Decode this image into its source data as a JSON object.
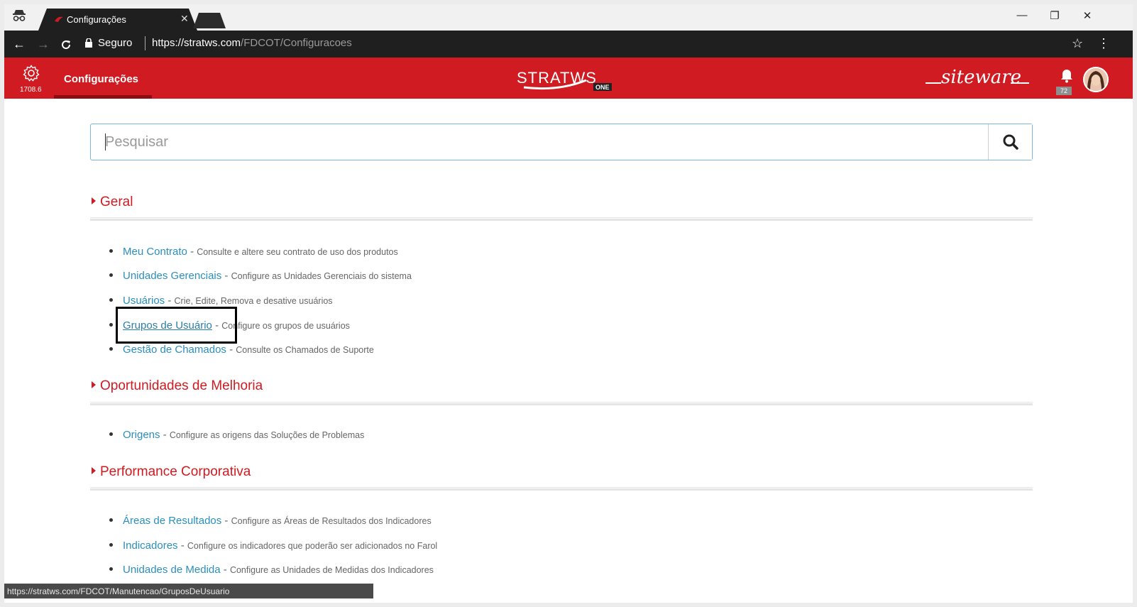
{
  "browser": {
    "tab_title": "Configurações",
    "secure_label": "Seguro",
    "url_host": "https://stratws.com",
    "url_path": "/FDCOT/Configuracoes",
    "status_url": "https://stratws.com/FDCOT/Manutencao/GruposDeUsuario"
  },
  "header": {
    "version": "1708.6",
    "title": "Configurações",
    "logo_text": "STRATWS",
    "logo_badge": "ONE",
    "brand_text": "siteware",
    "notification_count": "72",
    "color": "#cf1b21"
  },
  "search": {
    "placeholder": "Pesquisar"
  },
  "sections": [
    {
      "title": "Geral",
      "items": [
        {
          "link": "Meu Contrato",
          "desc": "Consulte e altere seu contrato de uso dos produtos"
        },
        {
          "link": "Unidades Gerenciais",
          "desc": "Configure as Unidades Gerenciais do sistema"
        },
        {
          "link": "Usuários",
          "desc": "Crie, Edite, Remova e desative usuários"
        },
        {
          "link": "Grupos de Usuário",
          "desc": "Configure os grupos de usuários"
        },
        {
          "link": "Gestão de Chamados",
          "desc": "Consulte os Chamados de Suporte"
        }
      ]
    },
    {
      "title": "Oportunidades de Melhoria",
      "items": [
        {
          "link": "Origens",
          "desc": "Configure as origens das Soluções de Problemas"
        }
      ]
    },
    {
      "title": "Performance Corporativa",
      "items": [
        {
          "link": "Áreas de Resultados",
          "desc": "Configure as Áreas de Resultados dos Indicadores"
        },
        {
          "link": "Indicadores",
          "desc": "Configure os indicadores que poderão ser adicionados no Farol"
        },
        {
          "link": "Unidades de Medida",
          "desc": "Configure as Unidades de Medidas dos Indicadores"
        }
      ]
    }
  ]
}
